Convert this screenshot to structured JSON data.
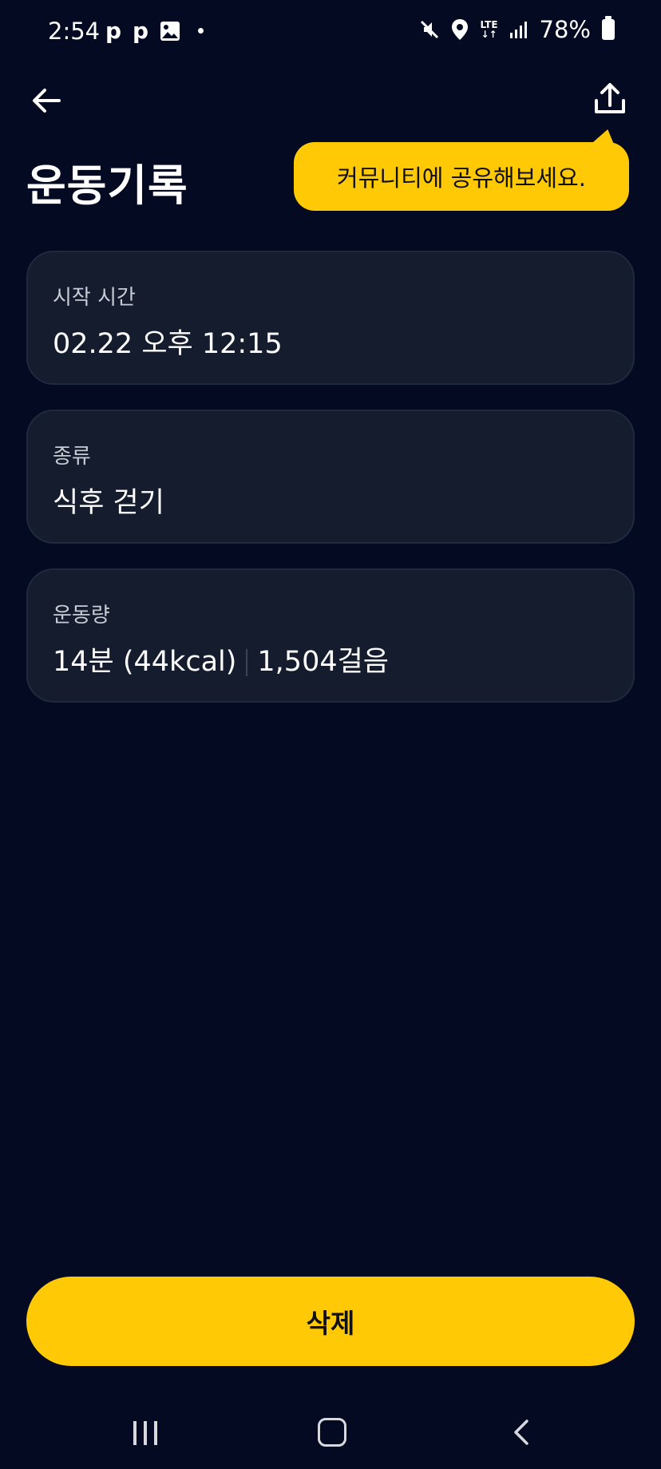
{
  "status_bar": {
    "time": "2:54",
    "notification_icons": [
      "p",
      "p"
    ],
    "network": "LTE",
    "battery": "78%"
  },
  "header": {
    "title": "운동기록",
    "tooltip": "커뮤니티에 공유해보세요."
  },
  "cards": [
    {
      "label": "시작 시간",
      "value": "02.22 오후 12:15"
    },
    {
      "label": "종류",
      "value": "식후 걷기"
    },
    {
      "label": "운동량",
      "value_duration": "14분 (44kcal)",
      "value_steps": "1,504걸음"
    }
  ],
  "actions": {
    "delete_label": "삭제"
  },
  "colors": {
    "background": "#030a21",
    "card": "#141c2e",
    "accent": "#ffc905"
  }
}
